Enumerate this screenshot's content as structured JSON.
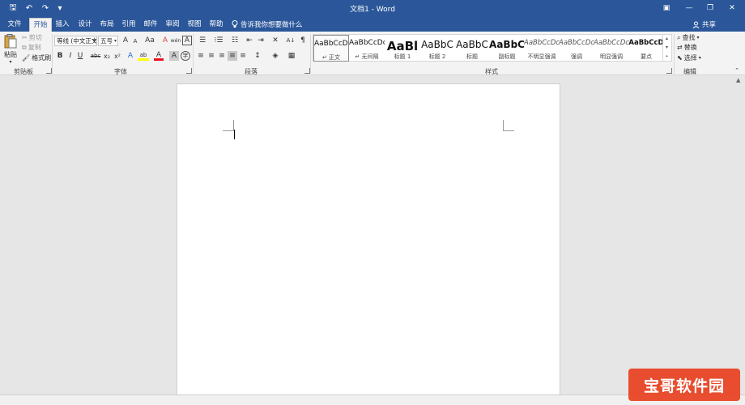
{
  "titlebar": {
    "title": "文档1 - Word",
    "save_glyph": "🖫",
    "undo_glyph": "↶",
    "redo_glyph": "↷",
    "customize_glyph": "▾",
    "ribbon_options_glyph": "▣",
    "minimize_glyph": "—",
    "maximize_glyph": "❐",
    "close_glyph": "✕"
  },
  "tabs": [
    {
      "label": "文件",
      "active": false
    },
    {
      "label": "开始",
      "active": true
    },
    {
      "label": "插入",
      "active": false
    },
    {
      "label": "设计",
      "active": false
    },
    {
      "label": "布局",
      "active": false
    },
    {
      "label": "引用",
      "active": false
    },
    {
      "label": "邮件",
      "active": false
    },
    {
      "label": "审阅",
      "active": false
    },
    {
      "label": "视图",
      "active": false
    },
    {
      "label": "帮助",
      "active": false
    }
  ],
  "tell_me": "告诉我你想要做什么",
  "share": "共享",
  "clipboard": {
    "paste": "粘贴",
    "cut": "剪切",
    "copy": "复制",
    "format_painter": "格式刷",
    "group_label": "剪贴板"
  },
  "font": {
    "font_name": "等线 (中文正文",
    "font_size": "五号",
    "grow": "A",
    "shrink": "A",
    "change_case": "Aa",
    "clear_format": "A",
    "phonetic": "wén",
    "char_border": "A",
    "bold": "B",
    "italic": "I",
    "underline": "U",
    "strike": "abc",
    "subscript": "x₂",
    "superscript": "x²",
    "text_effects": "A",
    "highlight": "ab",
    "font_color": "A",
    "char_shading": "A",
    "enclose": "字",
    "group_label": "字体",
    "font_color_hex": "#e81123",
    "highlight_hex": "#ffff00"
  },
  "paragraph": {
    "bullets": "☰",
    "numbering": "⁝☰",
    "multilevel": "☷",
    "decrease_indent": "⇤",
    "increase_indent": "⇥",
    "chinese_layout": "✕",
    "sort": "A↓",
    "show_marks": "¶",
    "align_left": "≡",
    "center": "≡",
    "align_right": "≡",
    "justify": "≡",
    "distributed": "≡",
    "line_spacing": "↕",
    "shading": "◈",
    "borders": "▦",
    "group_label": "段落"
  },
  "styles": {
    "group_label": "样式",
    "items": [
      {
        "preview": "AaBbCcDc",
        "name": "↵ 正文",
        "size": 9,
        "bold": false,
        "italic": false,
        "selected": true
      },
      {
        "preview": "AaBbCcDc",
        "name": "↵ 无间隔",
        "size": 9,
        "bold": false,
        "italic": false,
        "selected": false
      },
      {
        "preview": "AaBl",
        "name": "标题 1",
        "size": 15,
        "bold": true,
        "italic": false,
        "selected": false
      },
      {
        "preview": "AaBbC",
        "name": "标题 2",
        "size": 12,
        "bold": false,
        "italic": false,
        "selected": false
      },
      {
        "preview": "AaBbC",
        "name": "标题",
        "size": 12,
        "bold": false,
        "italic": false,
        "selected": false
      },
      {
        "preview": "AaBbC",
        "name": "副标题",
        "size": 12,
        "bold": true,
        "italic": false,
        "selected": false
      },
      {
        "preview": "AaBbCcDc",
        "name": "不明显强调",
        "size": 8.5,
        "bold": false,
        "italic": true,
        "selected": false
      },
      {
        "preview": "AaBbCcDc",
        "name": "强调",
        "size": 8.5,
        "bold": false,
        "italic": true,
        "selected": false
      },
      {
        "preview": "AaBbCcDc",
        "name": "明显强调",
        "size": 8.5,
        "bold": false,
        "italic": true,
        "selected": false
      },
      {
        "preview": "AaBbCcD",
        "name": "要点",
        "size": 8.5,
        "bold": true,
        "italic": false,
        "selected": false
      }
    ]
  },
  "editing": {
    "find": "查找",
    "replace": "替换",
    "select": "选择",
    "group_label": "编辑"
  },
  "watermark": "宝哥软件园",
  "colors": {
    "brand": "#2b579a"
  }
}
